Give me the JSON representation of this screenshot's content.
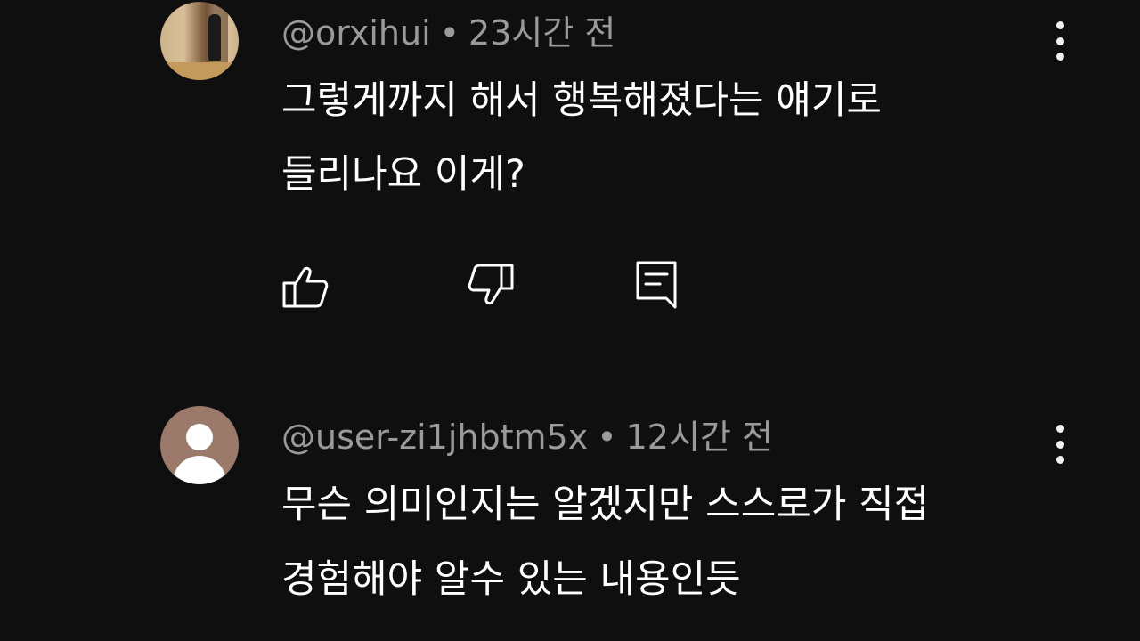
{
  "comments": [
    {
      "author": "@orxihui",
      "separator": "•",
      "time": "23시간 전",
      "lines": [
        "그렇게까지 해서 행복해졌다는 얘기로",
        "들리나요 이게?"
      ],
      "avatar": "photo-avatar",
      "actions": {
        "like_icon": "thumbs-up-icon",
        "dislike_icon": "thumbs-down-icon",
        "reply_icon": "reply-comment-icon"
      },
      "menu_icon": "more-vertical-icon"
    },
    {
      "author": "@user-zi1jhbtm5x",
      "separator": "•",
      "time": "12시간 전",
      "lines": [
        "무슨 의미인지는 알겠지만 스스로가 직접",
        "경험해야 알수 있는 내용인듯"
      ],
      "avatar": "default-user-avatar",
      "menu_icon": "more-vertical-icon"
    }
  ],
  "colors": {
    "background": "#0f0f0f",
    "text": "#ffffff",
    "meta": "#9a9a9a",
    "default_avatar_bg": "#9b7a6c"
  }
}
